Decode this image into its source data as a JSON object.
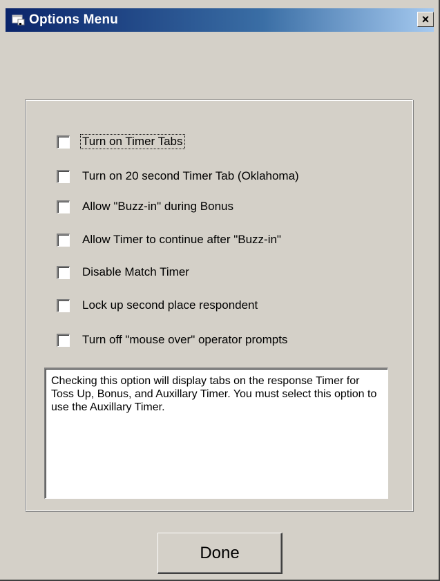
{
  "window": {
    "title": "Options Menu",
    "title_icon": "app-window-icon",
    "close_label": "×",
    "accent_color": "#0a246a",
    "background_color": "#d4d0c8"
  },
  "options": [
    {
      "label": "Turn on Timer Tabs",
      "checked": false,
      "focused": true
    },
    {
      "label": "Turn on 20 second Timer Tab (Oklahoma)",
      "checked": false,
      "focused": false
    },
    {
      "label": "Allow \"Buzz-in\" during Bonus",
      "checked": false,
      "focused": false
    },
    {
      "label": "Allow Timer to continue after \"Buzz-in\"",
      "checked": false,
      "focused": false
    },
    {
      "label": "Disable Match Timer",
      "checked": false,
      "focused": false
    },
    {
      "label": "Lock up second place respondent",
      "checked": false,
      "focused": false
    },
    {
      "label": "Turn off \"mouse over\" operator prompts",
      "checked": false,
      "focused": false
    }
  ],
  "description": {
    "text": "Checking this option will display tabs on the response Timer for Toss Up, Bonus, and Auxillary Timer.  You must select this option to use the Auxillary Timer."
  },
  "done_button": {
    "label": "Done"
  }
}
